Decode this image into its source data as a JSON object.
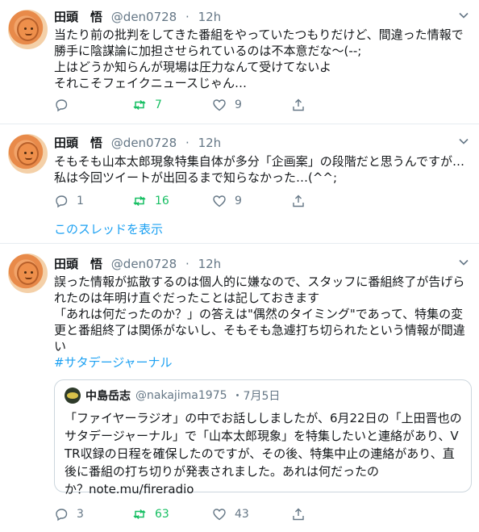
{
  "tweets": [
    {
      "name": "田頭　悟",
      "handle": "@den0728",
      "time": "12h",
      "lines": [
        "当たり前の批判をしてきた番組をやっていたつもりだけど、間違った情報で",
        "勝手に陰謀論に加担させられているのは不本意だな〜(--;",
        "上はどうか知らんが現場は圧力なんて受けてないよ",
        "それこそフェイクニュースじゃん…"
      ],
      "replies": "",
      "retweets": "7",
      "likes": "9"
    },
    {
      "name": "田頭　悟",
      "handle": "@den0728",
      "time": "12h",
      "lines": [
        "そもそも山本太郎現象特集自体が多分「企画案」の段階だと思うんですが…",
        "私は今回ツイートが出回るまで知らなかった…(^^;"
      ],
      "replies": "1",
      "retweets": "16",
      "likes": "9",
      "thread_link": "このスレッドを表示"
    },
    {
      "name": "田頭　悟",
      "handle": "@den0728",
      "time": "12h",
      "lines": [
        "誤った情報が拡散するのは個人的に嫌なので、スタッフに番組終了が告げら",
        "れたのは年明け直ぐだったことは記しておきます",
        "「あれは何だったのか？」の答えは\"偶然のタイミング\"であって、特集の変",
        "更と番組終了は関係がないし、そもそも急遽打ち切られたという情報が間違",
        "い"
      ],
      "hashtag": "#サタデージャーナル",
      "quote": {
        "name": "中島岳志",
        "handle": "@nakajima1975",
        "date": "・7月5日",
        "lines": [
          "「ファイヤーラジオ」の中でお話ししましたが、6月22日の「上田晋也の",
          "サタデージャーナル」で「山本太郎現象」を特集したいと連絡があり、V",
          "TR収録の日程を確保したのですが、その後、特集中止の連絡があり、直",
          "後に番組の打ち切りが発表されました。あれは何だったの",
          "か？note.mu/fireradio"
        ]
      },
      "replies": "3",
      "retweets": "63",
      "likes": "43"
    }
  ],
  "colors": {
    "text": "#14171a",
    "secondary": "#657786",
    "link": "#1da1f2",
    "retweet": "#17bf63",
    "divider": "#e6ecf0"
  },
  "icons": [
    "reply-icon",
    "retweet-icon",
    "like-icon",
    "share-icon",
    "chevron-down-icon"
  ]
}
